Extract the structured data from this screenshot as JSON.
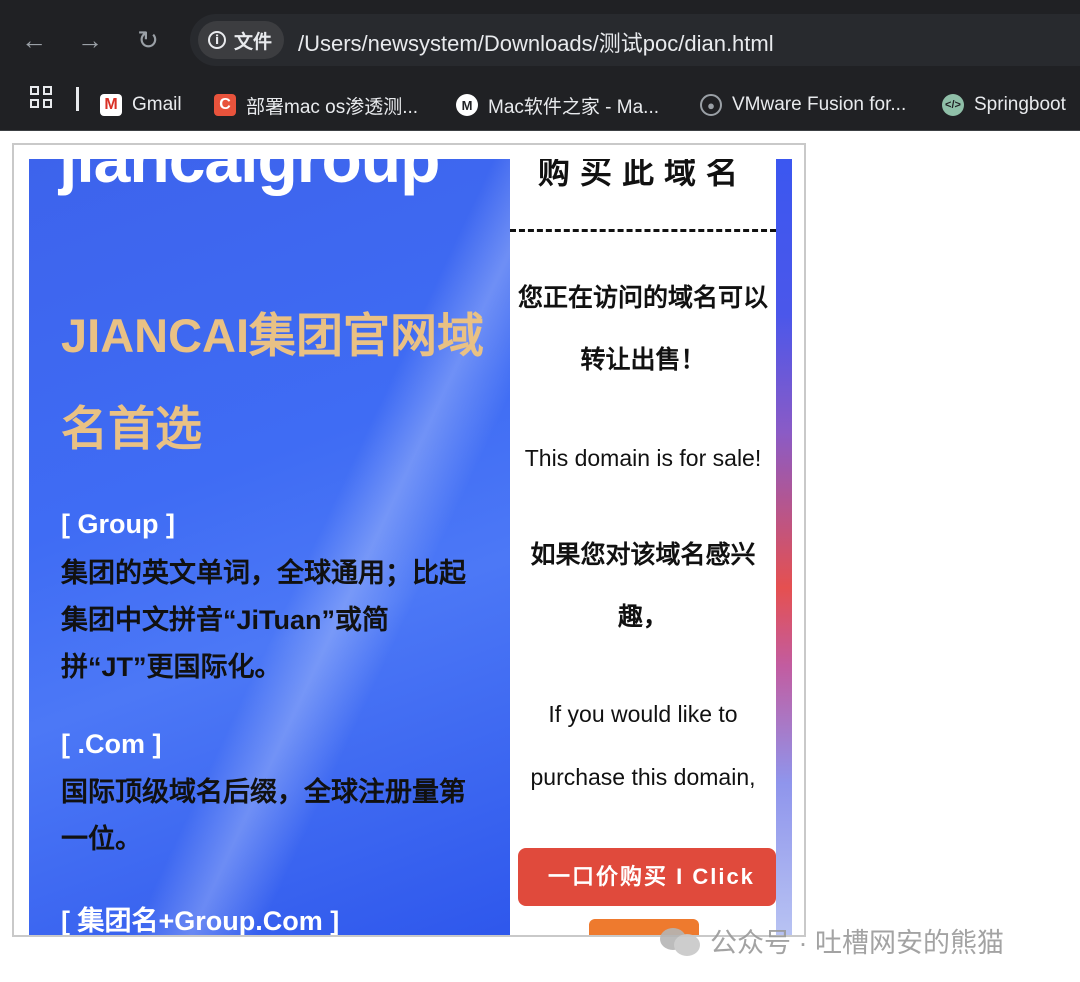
{
  "browser": {
    "site_label": "文件",
    "url": "/Users/newsystem/Downloads/测试poc/dian.html",
    "bookmarks": [
      {
        "label": "Gmail",
        "icon": "gmail-icon"
      },
      {
        "label": "部署mac os渗透测...",
        "icon": "c-icon"
      },
      {
        "label": "Mac软件之家 - Ma...",
        "icon": "m-icon"
      },
      {
        "label": "VMware Fusion for...",
        "icon": "github-icon"
      },
      {
        "label": "Springboot",
        "icon": "code-icon"
      }
    ],
    "colors": {
      "chrome_bg": "#202124",
      "text": "#e8eaed"
    }
  },
  "page": {
    "left": {
      "title": "jiancaigroup",
      "headline": "JIANCAI集团官网域名首选",
      "sections": [
        {
          "head": "[ Group ]",
          "body": "集团的英文单词，全球通用；比起集团中文拼音“JiTuan”或简拼“JT”更国际化。"
        },
        {
          "head": "[ .Com ]",
          "body": "国际顶级域名后缀，全球注册量第一位。"
        },
        {
          "head": "[ 集团名+Group.Com ]",
          "body": ""
        }
      ],
      "colors": {
        "panel": "#3f6cf4",
        "headline": "#e9c184"
      }
    },
    "right": {
      "buy_title": "购买此域名",
      "zh_visiting": "您正在访问的域名可以转让出售！",
      "en_for_sale": "This domain is for sale!",
      "zh_interested": "如果您对该域名感兴趣，",
      "en_interested": "If you would like to purchase this domain,",
      "buy_button": "一口价购买 I Click",
      "colors": {
        "buy_button": "#e04a3c",
        "second_button": "#ee7a2e"
      }
    }
  },
  "watermark": {
    "text": "公众号 · 吐槽网安的熊猫",
    "icon": "wechat-icon"
  }
}
